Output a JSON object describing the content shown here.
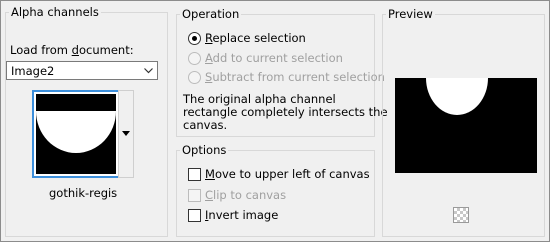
{
  "alpha_channels": {
    "title": "Alpha channels",
    "load_label_pre": "Load from ",
    "load_label_ul": "d",
    "load_label_post": "ocument:",
    "document_value": "Image2",
    "channel_name": "gothik-regis"
  },
  "operation": {
    "title": "Operation",
    "options": [
      {
        "ul": "R",
        "rest": "eplace selection",
        "selected": true,
        "enabled": true
      },
      {
        "ul": "A",
        "rest": "dd to current selection",
        "selected": false,
        "enabled": false
      },
      {
        "ul": "S",
        "rest": "ubtract from current selection",
        "selected": false,
        "enabled": false
      }
    ],
    "note_line1": "The original alpha channel",
    "note_line2": "rectangle completely intersects the",
    "note_line3": "canvas."
  },
  "options": {
    "title": "Options",
    "items": [
      {
        "ul": "M",
        "rest": "ove to upper left of canvas",
        "checked": false,
        "enabled": true
      },
      {
        "ul": "C",
        "rest": "lip to canvas",
        "checked": false,
        "enabled": false
      },
      {
        "ul": "I",
        "rest": "nvert image",
        "checked": false,
        "enabled": true
      }
    ]
  },
  "preview": {
    "title": "Preview",
    "zoom_icon": "checkerboard-zoom-icon"
  },
  "colors": {
    "accent": "#3c8fdc",
    "canvas": "#000000",
    "selection": "#ffffff",
    "disabled_text": "#a0a0a0"
  }
}
